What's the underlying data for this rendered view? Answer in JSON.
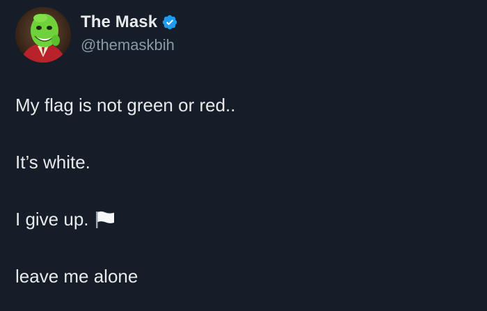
{
  "tweet": {
    "author": {
      "display_name": "The Mask",
      "handle": "@themaskbih",
      "verified": true,
      "verified_icon": "verified-badge-icon",
      "verified_color": "#1d9bf0",
      "avatar_icon": "profile-avatar"
    },
    "lines": [
      "My flag is not green or red..",
      "It’s white.",
      "I give up.",
      "leave me alone"
    ],
    "emoji_after_line_3": "white-flag-icon"
  },
  "colors": {
    "background": "#151d28",
    "text_primary": "#e7e9ea",
    "text_secondary": "#8b98a5"
  }
}
